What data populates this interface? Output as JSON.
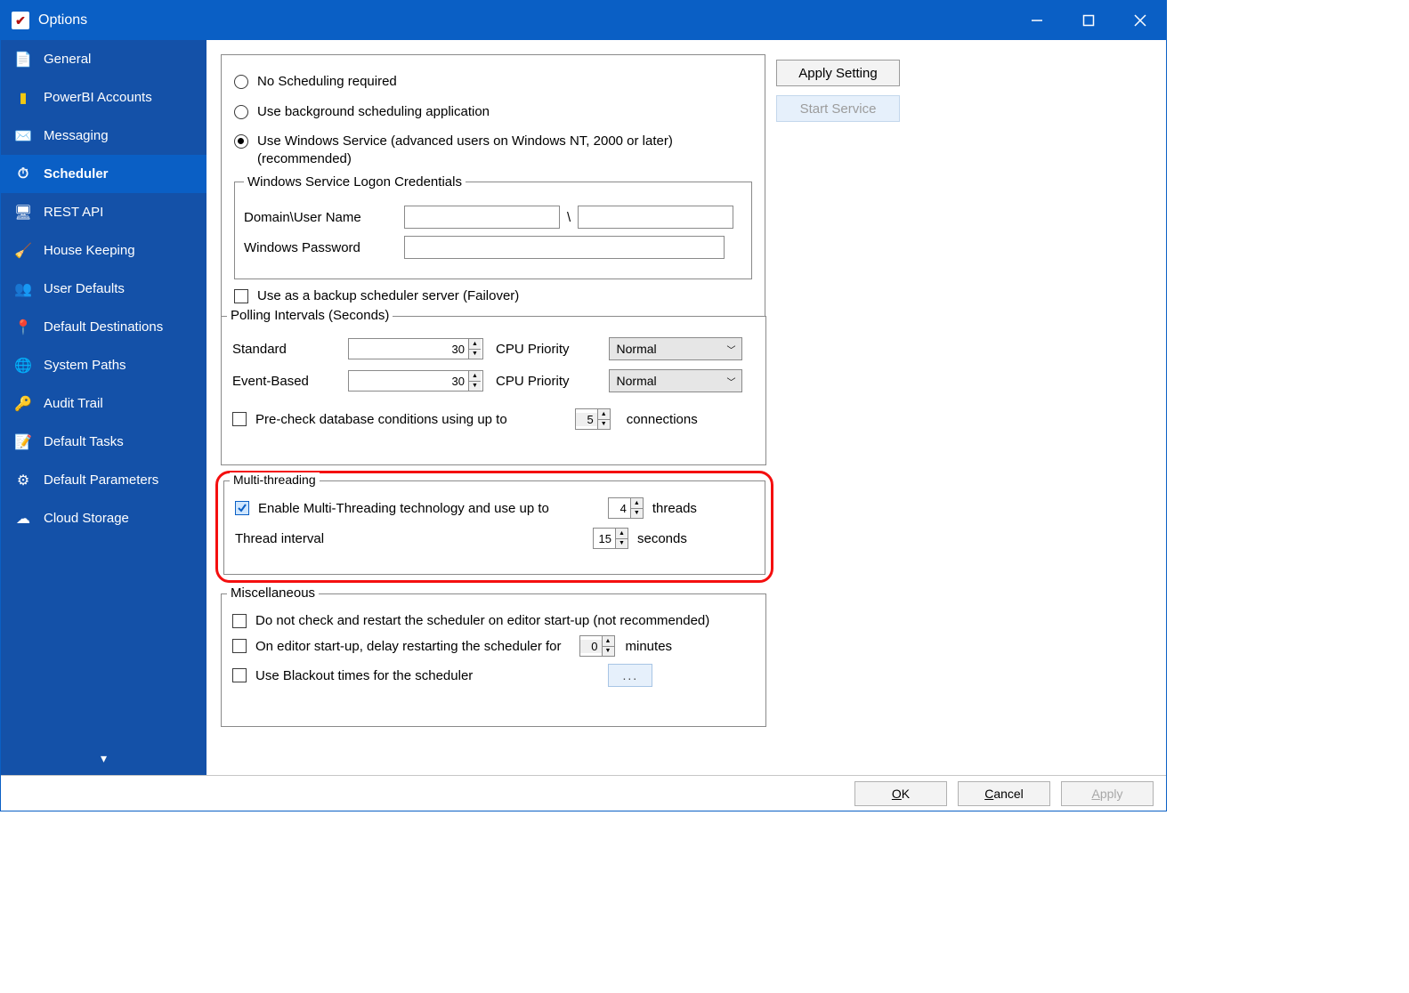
{
  "window": {
    "title": "Options"
  },
  "titlebar_buttons": {
    "minimize": "minimize",
    "maximize": "maximize",
    "close": "close"
  },
  "sidebar": {
    "items": [
      {
        "label": "General"
      },
      {
        "label": "PowerBI Accounts"
      },
      {
        "label": "Messaging"
      },
      {
        "label": "Scheduler"
      },
      {
        "label": "REST API"
      },
      {
        "label": "House Keeping"
      },
      {
        "label": "User Defaults"
      },
      {
        "label": "Default Destinations"
      },
      {
        "label": "System Paths"
      },
      {
        "label": "Audit Trail"
      },
      {
        "label": "Default Tasks"
      },
      {
        "label": "Default Parameters"
      },
      {
        "label": "Cloud Storage"
      }
    ]
  },
  "scheduling": {
    "opt1": "No Scheduling required",
    "opt2": "Use background scheduling application",
    "opt3": "Use Windows Service (advanced users on Windows NT, 2000 or later) (recommended)",
    "credentials": {
      "legend": "Windows Service Logon Credentials",
      "user_label": "Domain\\User Name",
      "separator": "\\",
      "password_label": "Windows Password"
    },
    "failover": "Use as a backup scheduler server (Failover)"
  },
  "polling": {
    "legend": "Polling Intervals (Seconds)",
    "standard_label": "Standard",
    "standard_value": "30",
    "event_label": "Event-Based",
    "event_value": "30",
    "cpu_label": "CPU Priority",
    "cpu_value_1": "Normal",
    "cpu_value_2": "Normal",
    "precheck_label": "Pre-check database conditions using up to",
    "precheck_value": "5",
    "connections_label": "connections"
  },
  "multithreading": {
    "legend": "Multi-threading",
    "enable_label": "Enable Multi-Threading technology and use up to",
    "threads_value": "4",
    "threads_label": "threads",
    "interval_label": "Thread interval",
    "interval_value": "15",
    "seconds_label": "seconds"
  },
  "misc": {
    "legend": "Miscellaneous",
    "nocheck_label": "Do not check and restart the scheduler on editor start-up (not recommended)",
    "delay_label": "On editor start-up, delay restarting the scheduler for",
    "delay_value": "0",
    "minutes_label": "minutes",
    "blackout_label": "Use Blackout times for the scheduler",
    "ellipsis": "..."
  },
  "buttons": {
    "apply_setting": "Apply Setting",
    "start_service": "Start Service",
    "ok": "K",
    "ok_prefix": "O",
    "cancel": "ancel",
    "cancel_prefix": "C",
    "apply": "pply",
    "apply_prefix": "A"
  }
}
